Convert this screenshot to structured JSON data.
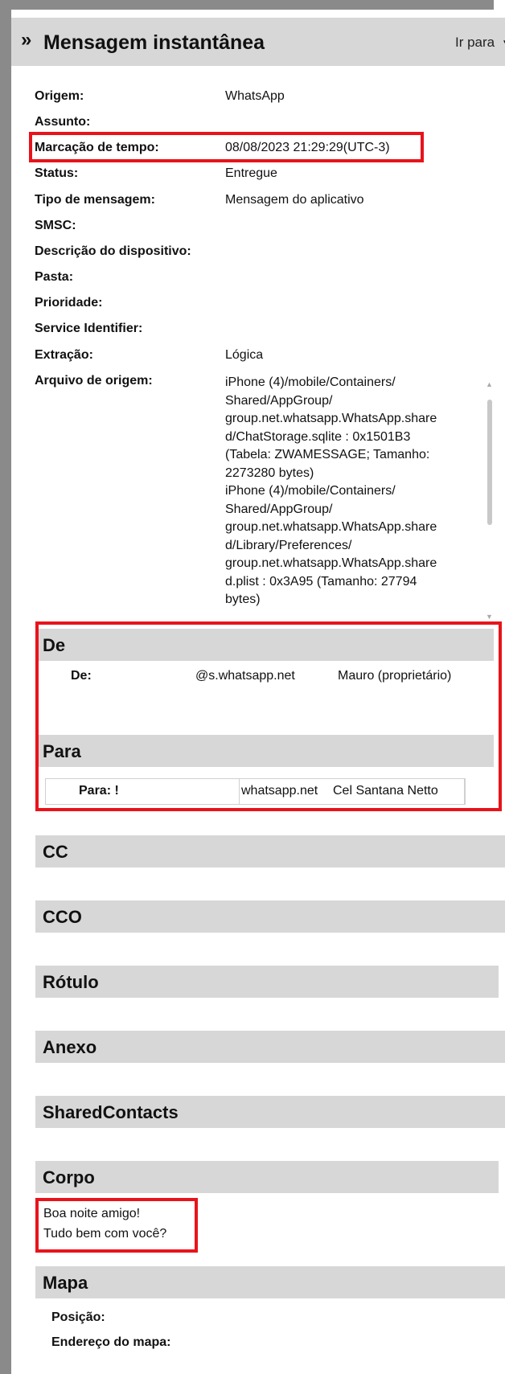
{
  "header": {
    "title": "Mensagem instantânea",
    "goto_label": "Ir para",
    "chevron": "»",
    "caret": "▾"
  },
  "properties": [
    {
      "label": "Origem:",
      "value": "WhatsApp"
    },
    {
      "label": "Assunto:",
      "value": ""
    },
    {
      "label": "Marcação de tempo:",
      "value": "08/08/2023 21:29:29(UTC-3)"
    },
    {
      "label": "Status:",
      "value": "Entregue"
    },
    {
      "label": "Tipo de mensagem:",
      "value": "Mensagem do aplicativo"
    },
    {
      "label": "SMSC:",
      "value": ""
    },
    {
      "label": "Descrição do dispositivo:",
      "value": ""
    },
    {
      "label": "Pasta:",
      "value": ""
    },
    {
      "label": "Prioridade:",
      "value": ""
    },
    {
      "label": "Service Identifier:",
      "value": ""
    },
    {
      "label": "Extração:",
      "value": "Lógica"
    },
    {
      "label": "Arquivo de origem:",
      "value": ""
    }
  ],
  "source_file_lines": [
    "iPhone (4)/mobile/Containers/",
    "Shared/AppGroup/",
    "group.net.whatsapp.WhatsApp.share",
    "d/ChatStorage.sqlite : 0x1501B3",
    "(Tabela: ZWAMESSAGE; Tamanho:",
    "2273280 bytes)",
    "iPhone (4)/mobile/Containers/",
    "Shared/AppGroup/",
    "group.net.whatsapp.WhatsApp.share",
    "d/Library/Preferences/",
    "group.net.whatsapp.WhatsApp.share",
    "d.plist : 0x3A95 (Tamanho: 27794",
    "bytes)"
  ],
  "sections": {
    "de": {
      "title": "De",
      "label": "De:",
      "address": "@s.whatsapp.net",
      "name": "Mauro (proprietário)"
    },
    "para": {
      "title": "Para",
      "label": "Para: !",
      "address": "whatsapp.net",
      "name": "Cel Santana Netto"
    },
    "cc": "CC",
    "cco": "CCO",
    "rotulo": "Rótulo",
    "anexo": "Anexo",
    "shared": "SharedContacts",
    "corpo": "Corpo",
    "mapa": "Mapa"
  },
  "body": {
    "line1": "Boa noite amigo!",
    "line2": "Tudo bem com você?"
  },
  "map": {
    "position_label": "Posição:",
    "address_label": "Endereço do mapa:"
  },
  "colors": {
    "highlight": "#e8131b",
    "section_bg": "#d7d7d7",
    "frame": "#8a8a8a"
  }
}
